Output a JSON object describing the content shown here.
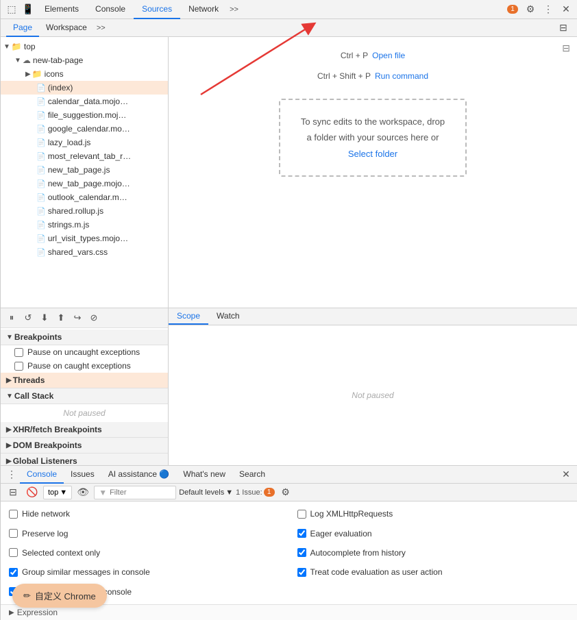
{
  "toolbar": {
    "tabs": [
      {
        "label": "Elements",
        "active": false
      },
      {
        "label": "Console",
        "active": false
      },
      {
        "label": "Sources",
        "active": true
      },
      {
        "label": "Network",
        "active": false
      }
    ],
    "more_tabs": ">>",
    "badge_count": "1",
    "settings_icon": "⚙",
    "more_icon": "⋮",
    "close_icon": "✕"
  },
  "sub_toolbar": {
    "tabs": [
      {
        "label": "Page",
        "active": true
      },
      {
        "label": "Workspace",
        "active": false
      }
    ],
    "more": ">>"
  },
  "file_tree": {
    "items": [
      {
        "indent": 0,
        "type": "folder",
        "expanded": true,
        "label": "top",
        "selected": false
      },
      {
        "indent": 1,
        "type": "folder-cloud",
        "expanded": true,
        "label": "new-tab-page",
        "selected": false
      },
      {
        "indent": 2,
        "type": "folder",
        "expanded": false,
        "label": "icons",
        "selected": false
      },
      {
        "indent": 3,
        "type": "file",
        "label": "(index)",
        "selected": true
      },
      {
        "indent": 3,
        "type": "file",
        "label": "calendar_data.mojo…",
        "selected": false
      },
      {
        "indent": 3,
        "type": "file",
        "label": "file_suggestion.moj…",
        "selected": false
      },
      {
        "indent": 3,
        "type": "file",
        "label": "google_calendar.mo…",
        "selected": false
      },
      {
        "indent": 3,
        "type": "file",
        "label": "lazy_load.js",
        "selected": false
      },
      {
        "indent": 3,
        "type": "file",
        "label": "most_relevant_tab_r…",
        "selected": false
      },
      {
        "indent": 3,
        "type": "file",
        "label": "new_tab_page.js",
        "selected": false
      },
      {
        "indent": 3,
        "type": "file",
        "label": "new_tab_page.mojo…",
        "selected": false
      },
      {
        "indent": 3,
        "type": "file",
        "label": "outlook_calendar.m…",
        "selected": false
      },
      {
        "indent": 3,
        "type": "file",
        "label": "shared.rollup.js",
        "selected": false
      },
      {
        "indent": 3,
        "type": "file",
        "label": "strings.m.js",
        "selected": false
      },
      {
        "indent": 3,
        "type": "file",
        "label": "url_visit_types.mojo…",
        "selected": false
      },
      {
        "indent": 3,
        "type": "file-css",
        "label": "shared_vars.css",
        "selected": false
      }
    ]
  },
  "editor": {
    "open_file_shortcut": "Ctrl + P",
    "open_file_label": "Open file",
    "run_command_shortcut": "Ctrl + Shift + P",
    "run_command_label": "Run command",
    "drop_zone_line1": "To sync edits to the workspace, drop",
    "drop_zone_line2": "a folder with your sources here or",
    "select_folder_label": "Select folder"
  },
  "debugger": {
    "toolbar_buttons": [
      "⏸",
      "▶",
      "⬇",
      "⬆",
      "↪",
      "⊘"
    ],
    "sections": {
      "breakpoints": {
        "label": "Breakpoints",
        "expanded": true,
        "items": [
          {
            "label": "Pause on uncaught exceptions",
            "checked": false
          },
          {
            "label": "Pause on caught exceptions",
            "checked": false
          }
        ]
      },
      "threads": {
        "label": "Threads",
        "expanded": false
      },
      "call_stack": {
        "label": "Call Stack",
        "expanded": true,
        "not_paused": "Not paused"
      },
      "xhr_fetch": {
        "label": "XHR/fetch Breakpoints",
        "expanded": false
      },
      "dom_breakpoints": {
        "label": "DOM Breakpoints",
        "expanded": false
      },
      "global_listeners": {
        "label": "Global Listeners",
        "expanded": false
      }
    },
    "scope_tabs": [
      {
        "label": "Scope",
        "active": true
      },
      {
        "label": "Watch",
        "active": false
      }
    ],
    "not_paused": "Not paused"
  },
  "console": {
    "tabs": [
      {
        "label": "Console",
        "active": true
      },
      {
        "label": "Issues",
        "active": false
      },
      {
        "label": "AI assistance 🔵",
        "active": false
      },
      {
        "label": "What's new",
        "active": false
      },
      {
        "label": "Search",
        "active": false
      }
    ],
    "toolbar": {
      "context": "top",
      "filter_placeholder": "Filter",
      "levels_label": "Default levels",
      "issues_count": "1 Issue:",
      "issues_badge": "1"
    },
    "options": [
      {
        "label": "Hide network",
        "checked": false,
        "col": 1
      },
      {
        "label": "Log XMLHttpRequests",
        "checked": false,
        "col": 2
      },
      {
        "label": "Preserve log",
        "checked": false,
        "col": 1
      },
      {
        "label": "Eager evaluation",
        "checked": true,
        "col": 2
      },
      {
        "label": "Selected context only",
        "checked": false,
        "col": 1
      },
      {
        "label": "Autocomplete from history",
        "checked": true,
        "col": 2
      },
      {
        "label": "Group similar messages in console",
        "checked": true,
        "col": 1
      },
      {
        "label": "Treat code evaluation as user action",
        "checked": true,
        "col": 2
      },
      {
        "label": "Show CORS errors in console",
        "checked": true,
        "col": 1
      }
    ],
    "expression_label": "Expression"
  },
  "custom_button": {
    "icon": "✏",
    "label": "自定义 Chrome"
  }
}
